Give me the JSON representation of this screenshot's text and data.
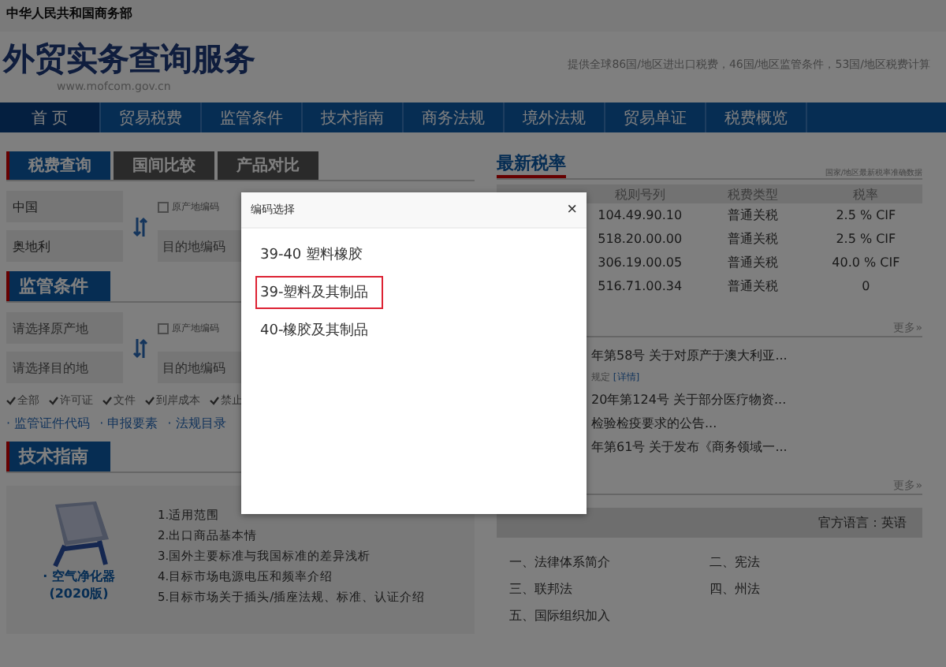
{
  "top_bar": {
    "ministry": "中华人民共和国商务部"
  },
  "header": {
    "title": "外贸实务查询服务",
    "url": "www.mofcom.gov.cn",
    "slogan": "提供全球86国/地区进出口税费，46国/地区监管条件，53国/地区税费计算"
  },
  "nav": [
    {
      "label": "首 页",
      "selected": true
    },
    {
      "label": "贸易税费",
      "selected": false
    },
    {
      "label": "监管条件",
      "selected": false
    },
    {
      "label": "技术指南",
      "selected": false
    },
    {
      "label": "商务法规",
      "selected": false
    },
    {
      "label": "境外法规",
      "selected": false
    },
    {
      "label": "贸易单证",
      "selected": false
    },
    {
      "label": "税费概览",
      "selected": false
    }
  ],
  "tax_query": {
    "tabs": [
      {
        "label": "税费查询",
        "selected": true
      },
      {
        "label": "国间比较",
        "selected": false
      },
      {
        "label": "产品对比",
        "selected": false
      }
    ],
    "origin": "中国",
    "destination": "奥地利",
    "origin_code": {
      "label": "原产地编码",
      "checked": false
    },
    "destination_code": {
      "placeholder": "目的地编码"
    }
  },
  "supervision": {
    "title": "监管条件",
    "origin": {
      "placeholder": "请选择原产地"
    },
    "destination": {
      "placeholder": "请选择目的地"
    },
    "origin_code": {
      "label": "原产地编码",
      "checked": false
    },
    "destination_code": {
      "placeholder": "目的地编码"
    },
    "filters": [
      {
        "label": "全部",
        "checked": true
      },
      {
        "label": "许可证",
        "checked": true
      },
      {
        "label": "文件",
        "checked": true
      },
      {
        "label": "到岸成本",
        "checked": true
      },
      {
        "label": "禁止",
        "checked": true
      }
    ],
    "links": [
      "· 监管证件代码",
      "· 申报要素",
      "· 法规目录"
    ]
  },
  "tech_guide": {
    "title": "技术指南",
    "book_title": "· 空气净化器",
    "book_edition": "(2020版)",
    "items": [
      "1.适用范围",
      "2.出口商品基本情",
      "3.国外主要标准与我国标准的差异浅析",
      "4.目标市场电源电压和频率介绍",
      "5.目标市场关于插头/插座法规、标准、认证介绍"
    ]
  },
  "latest_rates": {
    "title": "最新税率",
    "caption": "国家/地区最新税率准确数据",
    "columns": [
      "税则号列",
      "税费类型",
      "税率"
    ],
    "rows": [
      [
        "104.49.90.10",
        "普通关税",
        "2.5 % CIF"
      ],
      [
        "518.20.00.00",
        "普通关税",
        "2.5 % CIF"
      ],
      [
        "306.19.00.05",
        "普通关税",
        "40.0 % CIF"
      ],
      [
        "516.71.00.34",
        "普通关税",
        "0"
      ]
    ],
    "more": "更多»"
  },
  "news": {
    "items": [
      {
        "title": "年第58号 关于对原产于澳大利亚...",
        "summary": "规定",
        "detail": "[详情]"
      },
      {
        "title": "20年第124号 关于部分医疗物资..."
      },
      {
        "title": "检验检疫要求的公告..."
      },
      {
        "title": "年第61号 关于发布《商务领域一..."
      }
    ],
    "more": "更多»"
  },
  "foreign_law": {
    "language": "官方语言：英语",
    "items": [
      "一、法律体系简介",
      "二、宪法",
      "三、联邦法",
      "四、州法",
      "五、国际组织加入"
    ]
  },
  "dialog": {
    "title": "编码选择",
    "close": "×",
    "options": [
      {
        "label": "39-40 塑料橡胶",
        "selected": false
      },
      {
        "label": "39-塑料及其制品",
        "selected": true
      },
      {
        "label": "40-橡胶及其制品",
        "selected": false
      }
    ]
  }
}
